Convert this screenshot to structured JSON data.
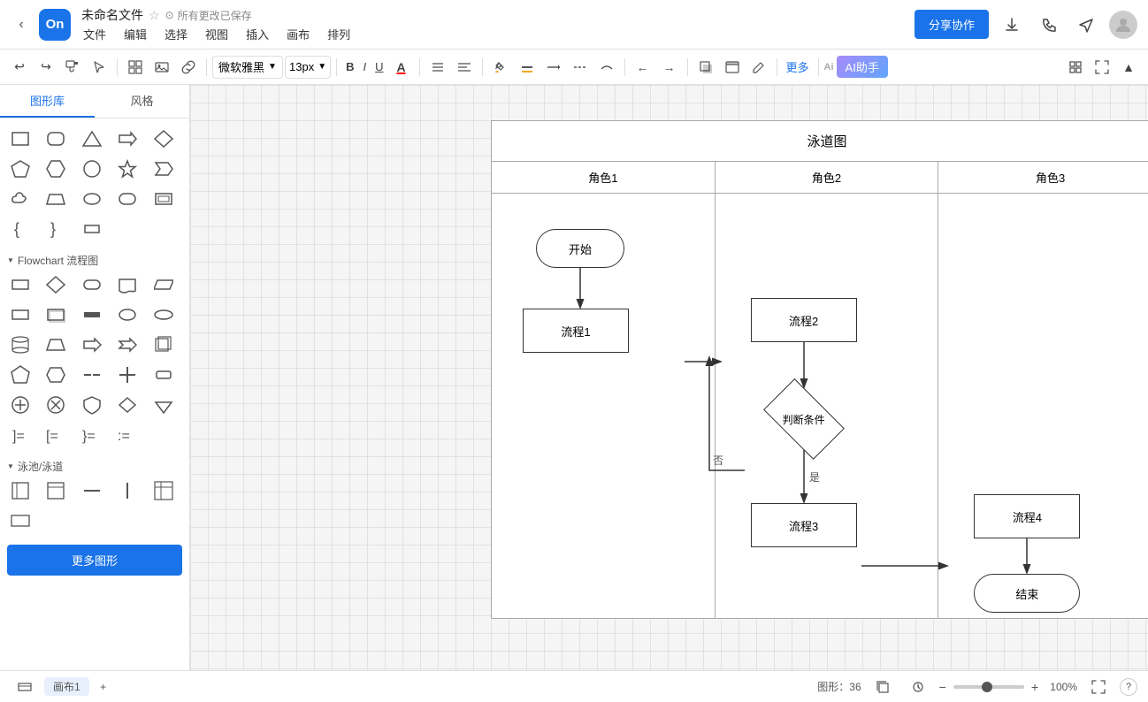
{
  "topbar": {
    "back_label": "‹",
    "logo": "On",
    "file_title": "未命名文件",
    "save_status": "所有更改已保存",
    "save_icon": "○",
    "menu_items": [
      "文件",
      "编辑",
      "选择",
      "视图",
      "插入",
      "画布",
      "排列"
    ],
    "share_btn": "分享协作",
    "download_icon": "↓",
    "phone_icon": "📞",
    "send_icon": "✈",
    "avatar_icon": "👤"
  },
  "toolbar": {
    "undo": "↩",
    "redo": "↪",
    "format_paint": "🖌",
    "pointer": "↖",
    "grid_icon": "⊞",
    "image_icon": "🖼",
    "link_icon": "🔗",
    "font_name": "微软雅黑",
    "font_size": "13px",
    "bold": "B",
    "italic": "I",
    "underline": "U",
    "font_color": "A",
    "list": "≡",
    "align": "≡",
    "fill_color": "🪣",
    "line_color": "—",
    "line_style": "—",
    "dash_style": "---",
    "waypoint": "~",
    "arrow_left": "←",
    "arrow_right": "→",
    "shadow": "☐",
    "container": "⊡",
    "edit": "✎",
    "more": "更多",
    "ai_label": "AI助手"
  },
  "left_panel": {
    "tab_shapes": "图形库",
    "tab_style": "风格",
    "more_shapes_btn": "更多图形",
    "section_flowchart": "Flowchart 流程图",
    "section_swimlane": "泳池/泳道"
  },
  "diagram": {
    "title": "泳道图",
    "lanes": [
      "角色1",
      "角色2",
      "角色3"
    ],
    "shapes": {
      "start": "开始",
      "process1": "流程1",
      "process2": "流程2",
      "decision": "判断条件",
      "process3": "流程3",
      "process4": "流程4",
      "end": "结束"
    },
    "arrow_labels": {
      "no": "否",
      "yes": "是"
    }
  },
  "statusbar": {
    "tab1": "画布1",
    "shapes_count": "图形：36",
    "zoom": "100%",
    "fullscreen_icon": "⛶",
    "help_icon": "?"
  }
}
